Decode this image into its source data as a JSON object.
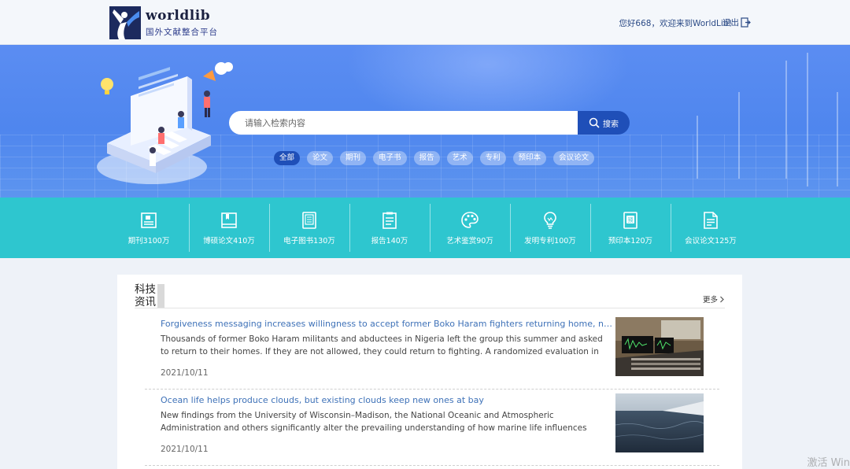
{
  "header": {
    "logo_title": "worldlib",
    "logo_subtitle": "国外文献整合平台",
    "greeting": "您好668，欢迎来到WorldLib！",
    "logout_label": "退出"
  },
  "search": {
    "placeholder": "请输入检索内容",
    "button_label": "搜索",
    "tags": [
      "全部",
      "论文",
      "期刊",
      "电子书",
      "报告",
      "艺术",
      "专利",
      "预印本",
      "会议论文"
    ]
  },
  "stats": [
    {
      "label": "期刊3100万",
      "icon": "journal-icon"
    },
    {
      "label": "博硕论文410万",
      "icon": "thesis-book-icon"
    },
    {
      "label": "电子图书130万",
      "icon": "ebook-icon"
    },
    {
      "label": "报告140万",
      "icon": "report-icon"
    },
    {
      "label": "艺术鉴赏90万",
      "icon": "palette-icon"
    },
    {
      "label": "发明专利100万",
      "icon": "lightbulb-icon"
    },
    {
      "label": "预印本120万",
      "icon": "preprint-icon"
    },
    {
      "label": "会议论文125万",
      "icon": "conference-paper-icon"
    }
  ],
  "news_section": {
    "title": "科技资讯",
    "more_label": "更多",
    "items": [
      {
        "title": "Forgiveness messaging increases willingness to accept former Boko Haram fighters returning home, new study shows",
        "summary": "Thousands of former Boko Haram militants and abductees in Nigeria left the group this summer and asked to return to their homes. If they are not allowed, they could return to fighting. A randomized evaluation in the Nigerian city…",
        "date": "2021/10/11",
        "thumb": "studio-mixing-console"
      },
      {
        "title": "Ocean life helps produce clouds, but existing clouds keep new ones at bay",
        "summary": "New findings from the University of Wisconsin–Madison, the National Oceanic and Atmospheric Administration and others significantly alter the prevailing understanding of how marine life influences clouds and may change the wa…",
        "date": "2021/10/11",
        "thumb": "ocean-aerial-view"
      }
    ]
  },
  "watermark": "激活 Win"
}
